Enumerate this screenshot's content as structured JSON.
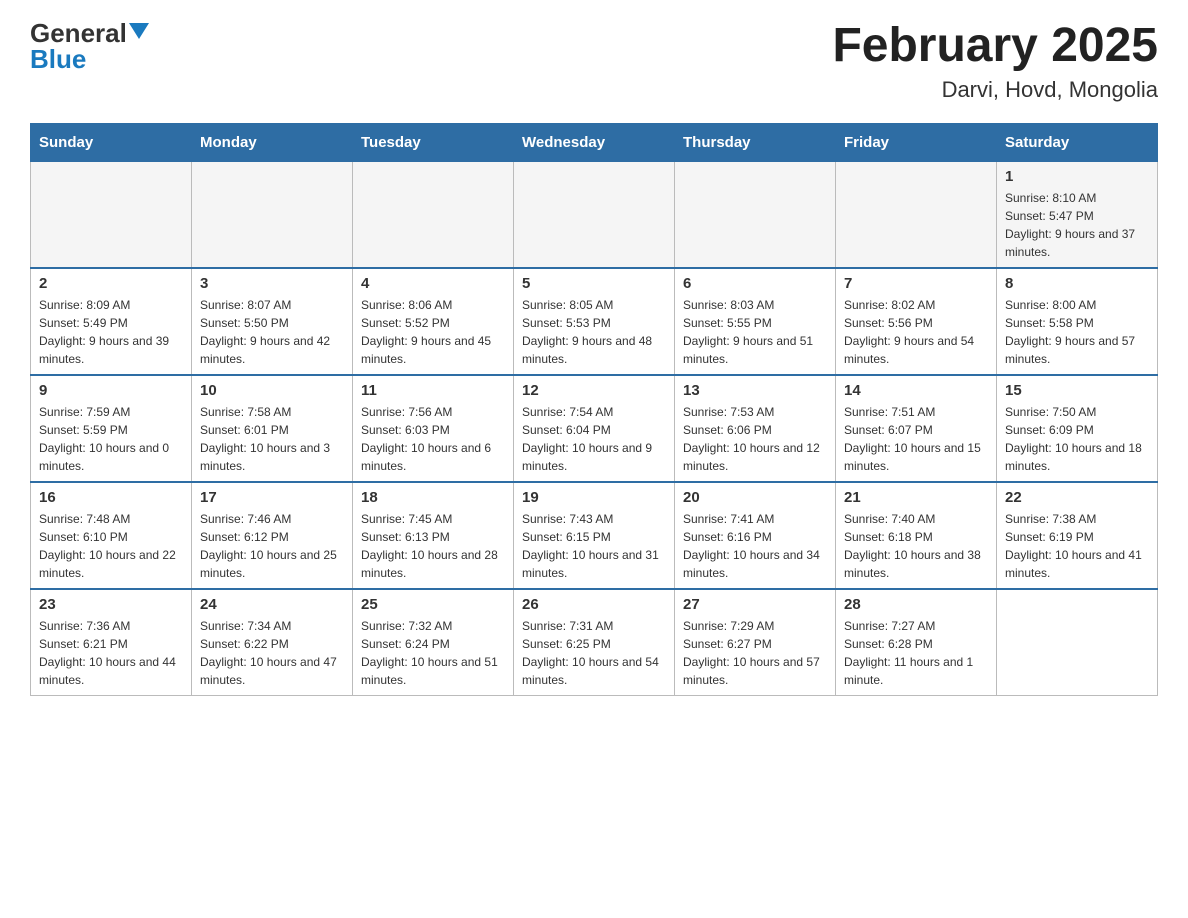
{
  "header": {
    "logo_general": "General",
    "logo_blue": "Blue",
    "month_title": "February 2025",
    "location": "Darvi, Hovd, Mongolia"
  },
  "weekdays": [
    "Sunday",
    "Monday",
    "Tuesday",
    "Wednesday",
    "Thursday",
    "Friday",
    "Saturday"
  ],
  "weeks": [
    [
      {
        "day": "",
        "info": ""
      },
      {
        "day": "",
        "info": ""
      },
      {
        "day": "",
        "info": ""
      },
      {
        "day": "",
        "info": ""
      },
      {
        "day": "",
        "info": ""
      },
      {
        "day": "",
        "info": ""
      },
      {
        "day": "1",
        "info": "Sunrise: 8:10 AM\nSunset: 5:47 PM\nDaylight: 9 hours and 37 minutes."
      }
    ],
    [
      {
        "day": "2",
        "info": "Sunrise: 8:09 AM\nSunset: 5:49 PM\nDaylight: 9 hours and 39 minutes."
      },
      {
        "day": "3",
        "info": "Sunrise: 8:07 AM\nSunset: 5:50 PM\nDaylight: 9 hours and 42 minutes."
      },
      {
        "day": "4",
        "info": "Sunrise: 8:06 AM\nSunset: 5:52 PM\nDaylight: 9 hours and 45 minutes."
      },
      {
        "day": "5",
        "info": "Sunrise: 8:05 AM\nSunset: 5:53 PM\nDaylight: 9 hours and 48 minutes."
      },
      {
        "day": "6",
        "info": "Sunrise: 8:03 AM\nSunset: 5:55 PM\nDaylight: 9 hours and 51 minutes."
      },
      {
        "day": "7",
        "info": "Sunrise: 8:02 AM\nSunset: 5:56 PM\nDaylight: 9 hours and 54 minutes."
      },
      {
        "day": "8",
        "info": "Sunrise: 8:00 AM\nSunset: 5:58 PM\nDaylight: 9 hours and 57 minutes."
      }
    ],
    [
      {
        "day": "9",
        "info": "Sunrise: 7:59 AM\nSunset: 5:59 PM\nDaylight: 10 hours and 0 minutes."
      },
      {
        "day": "10",
        "info": "Sunrise: 7:58 AM\nSunset: 6:01 PM\nDaylight: 10 hours and 3 minutes."
      },
      {
        "day": "11",
        "info": "Sunrise: 7:56 AM\nSunset: 6:03 PM\nDaylight: 10 hours and 6 minutes."
      },
      {
        "day": "12",
        "info": "Sunrise: 7:54 AM\nSunset: 6:04 PM\nDaylight: 10 hours and 9 minutes."
      },
      {
        "day": "13",
        "info": "Sunrise: 7:53 AM\nSunset: 6:06 PM\nDaylight: 10 hours and 12 minutes."
      },
      {
        "day": "14",
        "info": "Sunrise: 7:51 AM\nSunset: 6:07 PM\nDaylight: 10 hours and 15 minutes."
      },
      {
        "day": "15",
        "info": "Sunrise: 7:50 AM\nSunset: 6:09 PM\nDaylight: 10 hours and 18 minutes."
      }
    ],
    [
      {
        "day": "16",
        "info": "Sunrise: 7:48 AM\nSunset: 6:10 PM\nDaylight: 10 hours and 22 minutes."
      },
      {
        "day": "17",
        "info": "Sunrise: 7:46 AM\nSunset: 6:12 PM\nDaylight: 10 hours and 25 minutes."
      },
      {
        "day": "18",
        "info": "Sunrise: 7:45 AM\nSunset: 6:13 PM\nDaylight: 10 hours and 28 minutes."
      },
      {
        "day": "19",
        "info": "Sunrise: 7:43 AM\nSunset: 6:15 PM\nDaylight: 10 hours and 31 minutes."
      },
      {
        "day": "20",
        "info": "Sunrise: 7:41 AM\nSunset: 6:16 PM\nDaylight: 10 hours and 34 minutes."
      },
      {
        "day": "21",
        "info": "Sunrise: 7:40 AM\nSunset: 6:18 PM\nDaylight: 10 hours and 38 minutes."
      },
      {
        "day": "22",
        "info": "Sunrise: 7:38 AM\nSunset: 6:19 PM\nDaylight: 10 hours and 41 minutes."
      }
    ],
    [
      {
        "day": "23",
        "info": "Sunrise: 7:36 AM\nSunset: 6:21 PM\nDaylight: 10 hours and 44 minutes."
      },
      {
        "day": "24",
        "info": "Sunrise: 7:34 AM\nSunset: 6:22 PM\nDaylight: 10 hours and 47 minutes."
      },
      {
        "day": "25",
        "info": "Sunrise: 7:32 AM\nSunset: 6:24 PM\nDaylight: 10 hours and 51 minutes."
      },
      {
        "day": "26",
        "info": "Sunrise: 7:31 AM\nSunset: 6:25 PM\nDaylight: 10 hours and 54 minutes."
      },
      {
        "day": "27",
        "info": "Sunrise: 7:29 AM\nSunset: 6:27 PM\nDaylight: 10 hours and 57 minutes."
      },
      {
        "day": "28",
        "info": "Sunrise: 7:27 AM\nSunset: 6:28 PM\nDaylight: 11 hours and 1 minute."
      },
      {
        "day": "",
        "info": ""
      }
    ]
  ]
}
